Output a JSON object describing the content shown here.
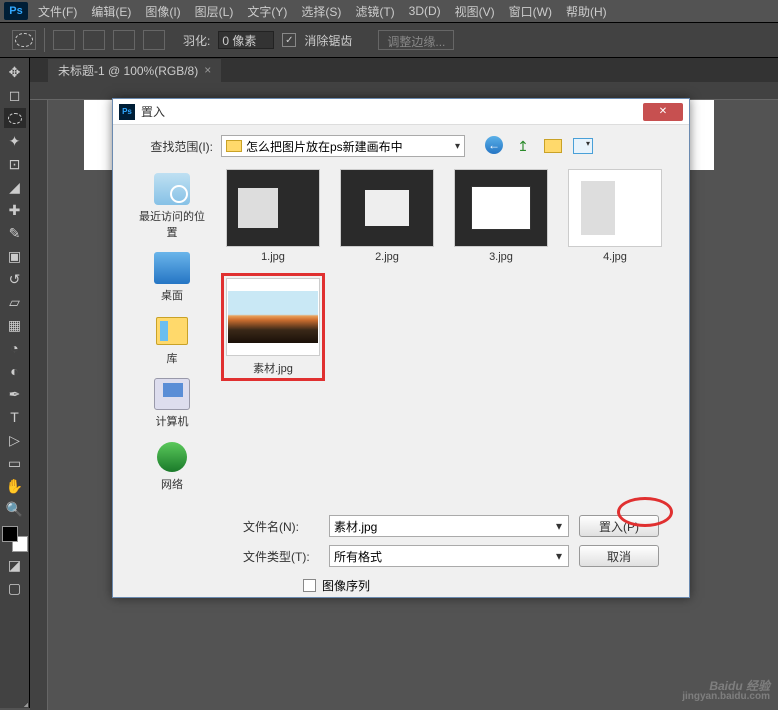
{
  "menu": {
    "file": "文件(F)",
    "edit": "编辑(E)",
    "image": "图像(I)",
    "layer": "图层(L)",
    "type": "文字(Y)",
    "select": "选择(S)",
    "filter": "滤镜(T)",
    "3d": "3D(D)",
    "view": "视图(V)",
    "window": "窗口(W)",
    "help": "帮助(H)"
  },
  "options": {
    "feather_label": "羽化:",
    "feather_value": "0 像素",
    "antialias": "消除锯齿",
    "adjust_edge": "调整边缘..."
  },
  "tab": {
    "title": "未标题-1 @ 100%(RGB/8)",
    "close": "×"
  },
  "dialog": {
    "title": "置入",
    "lookin_label": "查找范围(I):",
    "lookin_value": "怎么把图片放在ps新建画布中",
    "places": {
      "recent": "最近访问的位置",
      "desktop": "桌面",
      "library": "库",
      "computer": "计算机",
      "network": "网络"
    },
    "files": {
      "f1": "1.jpg",
      "f2": "2.jpg",
      "f3": "3.jpg",
      "f4": "4.jpg",
      "f5": "素材.jpg"
    },
    "filename_label": "文件名(N):",
    "filename_value": "素材.jpg",
    "filetype_label": "文件类型(T):",
    "filetype_value": "所有格式",
    "place_btn": "置入(P)",
    "cancel_btn": "取消",
    "sequence": "图像序列"
  },
  "watermark": {
    "main": "Baidu 经验",
    "sub": "jingyan.baidu.com"
  }
}
